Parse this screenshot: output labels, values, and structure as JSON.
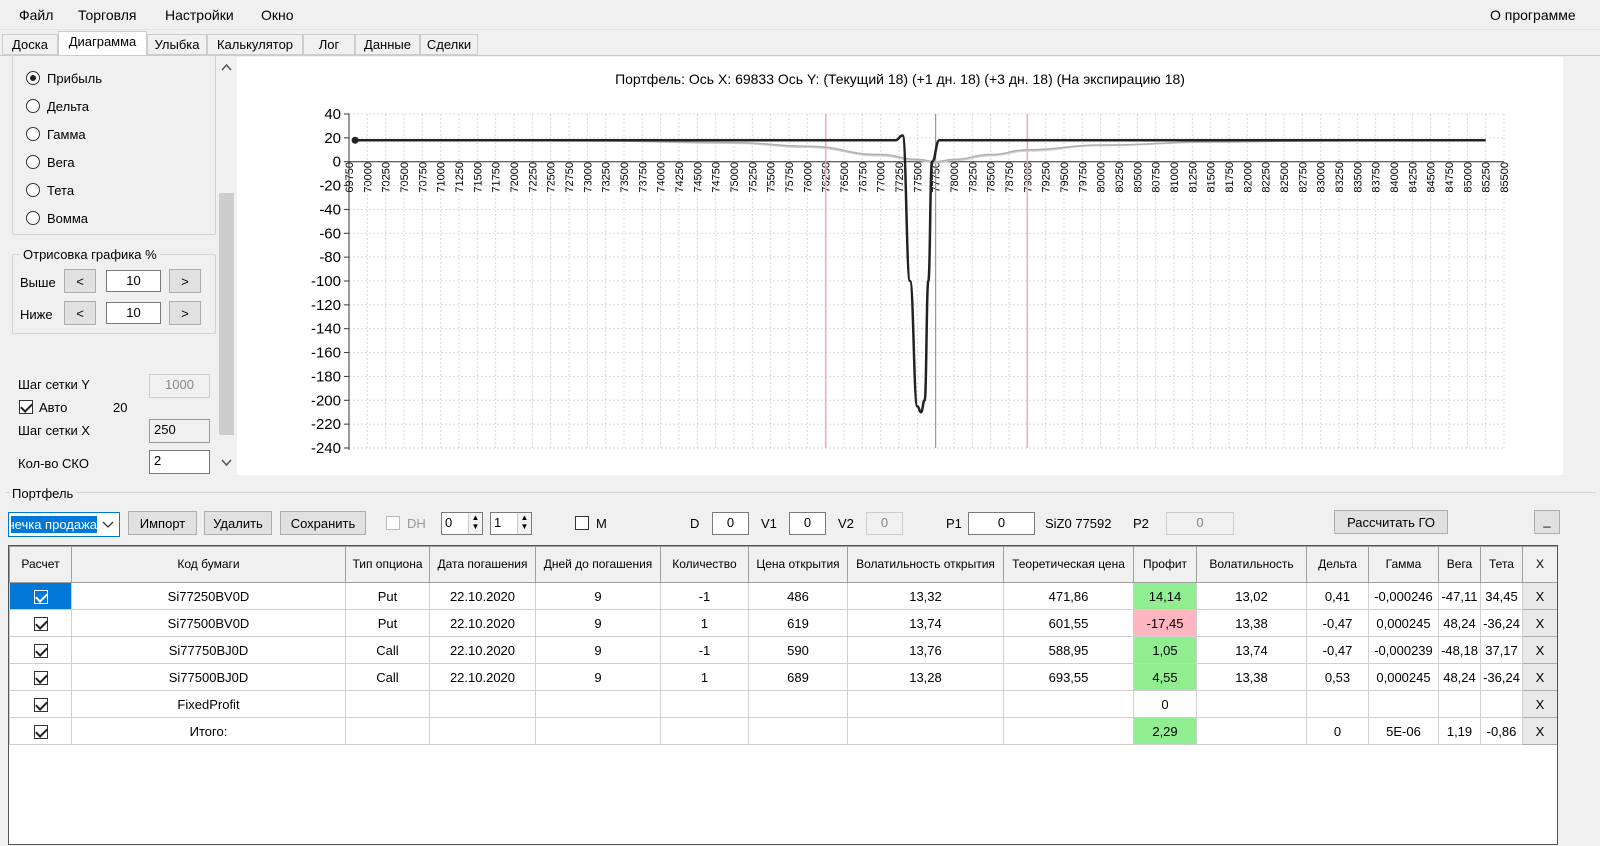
{
  "menu": {
    "items": [
      "Файл",
      "Торговля",
      "Настройки",
      "Окно"
    ],
    "about": "О программе"
  },
  "tabs": [
    "Доска",
    "Диаграмма",
    "Улыбка",
    "Калькулятор",
    "Лог",
    "Данные",
    "Сделки"
  ],
  "left": {
    "radios": [
      "Прибыль",
      "Дельта",
      "Гамма",
      "Вега",
      "Тета",
      "Вомма"
    ],
    "draw_group_title": "Отрисовка графика %",
    "above_label": "Выше",
    "above_value": "10",
    "below_label": "Ниже",
    "below_value": "10",
    "minus": "<",
    "plus": ">",
    "grid_y_label": "Шаг сетки Y",
    "grid_y_value": "1000",
    "auto_label": "Авто",
    "auto_value": "20",
    "grid_x_label": "Шаг сетки X",
    "grid_x_value": "250",
    "sko_label": "Кол-во СКО",
    "sko_value": "2"
  },
  "icons": {
    "scroll_up": "chevron-up-icon",
    "scroll_down": "chevron-down-icon"
  },
  "chart_data": {
    "type": "line",
    "title": "Портфель: Ось X: 69833 Ось Y:  (Текущий 18)  (+1 дн. 18)  (+3 дн. 18)  (На экспирацию 18)",
    "xlim": [
      69750,
      85500
    ],
    "ylim": [
      -240,
      40
    ],
    "xtick_step": 250,
    "ytick_step": 20,
    "grid": true,
    "cursor_x": 77750,
    "sd_lines": [
      76250,
      79000
    ],
    "series": [
      {
        "x": [
          69833,
          77000,
          77200,
          77300,
          77400,
          77500,
          77550,
          77600,
          77650,
          77700,
          77800,
          77900,
          78000,
          85250
        ],
        "values": [
          18,
          18,
          18,
          22,
          -100,
          -205,
          -210,
          -200,
          -100,
          0,
          18,
          18,
          18,
          18
        ],
        "color": "#222222"
      },
      {
        "x": [
          69833,
          73000,
          75000,
          76000,
          77000,
          77500,
          77750,
          78000,
          78500,
          79000,
          80000,
          81500,
          83000,
          85250
        ],
        "values": [
          18,
          17.5,
          16,
          13,
          6,
          2,
          0,
          2,
          6,
          10,
          14,
          16.5,
          17.5,
          18
        ],
        "color": "#b0b0b0"
      },
      {
        "x": [
          69833,
          73000,
          75000,
          76000,
          77000,
          77500,
          77750,
          78000,
          78500,
          79000,
          80000,
          81500,
          83000,
          85250
        ],
        "values": [
          18,
          17.5,
          15.5,
          12,
          5,
          1,
          -1,
          1,
          5,
          9,
          13.5,
          16.5,
          17.5,
          18
        ],
        "color": "#d0d0d0"
      }
    ]
  },
  "portfolio": {
    "title": "Портфель",
    "strategy_value": "Точечка продажа",
    "import": "Импорт",
    "delete": "Удалить",
    "save": "Сохранить",
    "dh_label": "DH",
    "spin1": "0",
    "spin2": "1",
    "m_label": "M",
    "d_label": "D",
    "d_value": "0",
    "v1_label": "V1",
    "v1_value": "0",
    "v2_label": "V2",
    "v2_value": "0",
    "p1_label": "P1",
    "p1_value": "0",
    "siz_label": "SiZ0 77592",
    "p2_label": "P2",
    "p2_value": "0",
    "calc_button": "Рассчитать ГО",
    "minimize": "_"
  },
  "grid": {
    "headers": [
      "Расчет",
      "Код бумаги",
      "Тип опциона",
      "Дата погашения",
      "Дней до погашения",
      "Количество",
      "Цена открытия",
      "Волатильность открытия",
      "Теоретическая цена",
      "Профит",
      "Волатильность",
      "Дельта",
      "Гамма",
      "Вега",
      "Тета",
      "X"
    ],
    "rows": [
      [
        "Si77250BV0D",
        "Put",
        "22.10.2020",
        "9",
        "-1",
        "486",
        "13,32",
        "471,86",
        "14,14",
        "13,02",
        "0,41",
        "-0,000246",
        "-47,11",
        "34,45",
        "X"
      ],
      [
        "Si77500BV0D",
        "Put",
        "22.10.2020",
        "9",
        "1",
        "619",
        "13,74",
        "601,55",
        "-17,45",
        "13,38",
        "-0,47",
        "0,000245",
        "48,24",
        "-36,24",
        "X"
      ],
      [
        "Si77750BJ0D",
        "Call",
        "22.10.2020",
        "9",
        "-1",
        "590",
        "13,76",
        "588,95",
        "1,05",
        "13,74",
        "-0,47",
        "-0,000239",
        "-48,18",
        "37,17",
        "X"
      ],
      [
        "Si77500BJ0D",
        "Call",
        "22.10.2020",
        "9",
        "1",
        "689",
        "13,28",
        "693,55",
        "4,55",
        "13,38",
        "0,53",
        "0,000245",
        "48,24",
        "-36,24",
        "X"
      ],
      [
        "FixedProfit",
        "",
        "",
        "",
        "",
        "",
        "",
        "",
        "0",
        "",
        "",
        "",
        "",
        "",
        "X"
      ],
      [
        "Итого:",
        "",
        "",
        "",
        "",
        "",
        "",
        "",
        "2,29",
        "",
        "0",
        "5E-06",
        "1,19",
        "-0,86",
        "X"
      ]
    ],
    "profit_colors": [
      "green",
      "pink",
      "green",
      "green",
      "",
      "green"
    ]
  }
}
